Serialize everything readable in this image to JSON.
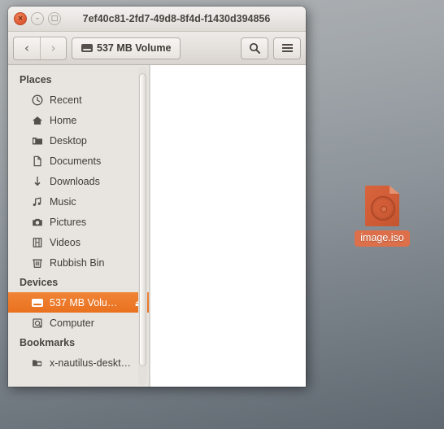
{
  "window": {
    "title": "7ef40c81-2fd7-49d8-8f4d-f1430d394856",
    "controls": {
      "close_label": "×",
      "minimize_label": "–",
      "maximize_label": "□"
    }
  },
  "toolbar": {
    "back_label": "‹",
    "forward_label": "›",
    "breadcrumb_label": "537 MB Volume",
    "breadcrumb_icon": "drive-icon",
    "search_label": "⚲",
    "menu_icon": "hamburger-icon"
  },
  "sidebar": {
    "sections": [
      {
        "header": "Places",
        "items": [
          {
            "label": "Recent",
            "icon": "clock-icon",
            "glyph": "◴"
          },
          {
            "label": "Home",
            "icon": "home-icon",
            "glyph": "⌂"
          },
          {
            "label": "Desktop",
            "icon": "folder-icon",
            "glyph": "🗀"
          },
          {
            "label": "Documents",
            "icon": "document-icon",
            "glyph": "□"
          },
          {
            "label": "Downloads",
            "icon": "download-icon",
            "glyph": "↓"
          },
          {
            "label": "Music",
            "icon": "music-note-icon",
            "glyph": "♫"
          },
          {
            "label": "Pictures",
            "icon": "camera-icon",
            "glyph": "◉"
          },
          {
            "label": "Videos",
            "icon": "film-icon",
            "glyph": "☰"
          },
          {
            "label": "Rubbish Bin",
            "icon": "trash-icon",
            "glyph": "▽"
          }
        ]
      },
      {
        "header": "Devices",
        "items": [
          {
            "label": "537 MB Volu…",
            "icon": "drive-icon",
            "selected": true,
            "eject": "⏏"
          },
          {
            "label": "Computer",
            "icon": "computer-icon",
            "glyph": "▣"
          }
        ]
      },
      {
        "header": "Bookmarks",
        "items": [
          {
            "label": "x-nautilus-deskt…",
            "icon": "remote-folder-icon",
            "glyph": "🗀"
          }
        ]
      }
    ]
  },
  "desktop": {
    "icon": {
      "label": "image.iso",
      "icon": "iso-disc-image-icon"
    }
  },
  "colors": {
    "selection_orange": "#e9711f",
    "label_orange": "#dd704a",
    "iso_orange": "#cf5c36",
    "sidebar_bg": "#e8e5e1",
    "content_bg": "#ffffff"
  }
}
